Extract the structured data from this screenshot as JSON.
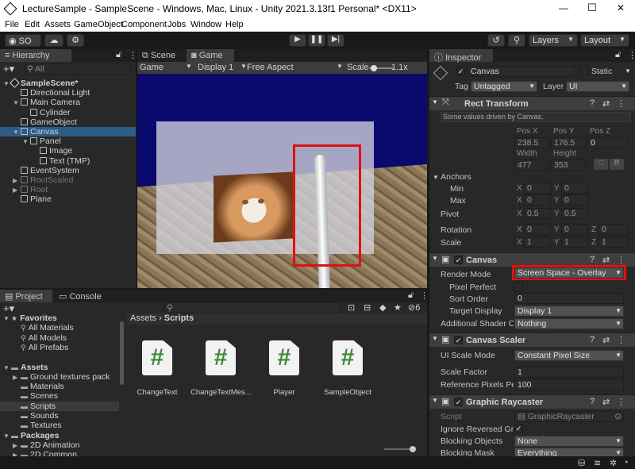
{
  "window": {
    "title": "LectureSample - SampleScene - Windows, Mac, Linux - Unity 2021.3.13f1 Personal* <DX11>",
    "min": "—",
    "max": "☐",
    "close": "✕"
  },
  "menu": [
    "File",
    "Edit",
    "Assets",
    "GameObject",
    "Component",
    "Jobs",
    "Window",
    "Help"
  ],
  "toolbar": {
    "account": "SO",
    "layers": "Layers",
    "layout": "Layout"
  },
  "hierarchy": {
    "tab": "Hierarchy",
    "search_placeholder": "All",
    "rows": [
      {
        "label": "SampleScene*",
        "depth": 0,
        "arrow": "▼",
        "icon": "unity-icon",
        "selected": false,
        "dim": false
      },
      {
        "label": "Directional Light",
        "depth": 1,
        "arrow": "",
        "icon": "cube-icon",
        "selected": false,
        "dim": false
      },
      {
        "label": "Main Camera",
        "depth": 1,
        "arrow": "▼",
        "icon": "cube-icon",
        "selected": false,
        "dim": false
      },
      {
        "label": "Cylinder",
        "depth": 2,
        "arrow": "",
        "icon": "cube-icon",
        "selected": false,
        "dim": false
      },
      {
        "label": "GameObject",
        "depth": 1,
        "arrow": "",
        "icon": "cube-icon",
        "selected": false,
        "dim": false
      },
      {
        "label": "Canvas",
        "depth": 1,
        "arrow": "▼",
        "icon": "cube-icon",
        "selected": true,
        "dim": false
      },
      {
        "label": "Panel",
        "depth": 2,
        "arrow": "▼",
        "icon": "cube-icon",
        "selected": false,
        "dim": false
      },
      {
        "label": "Image",
        "depth": 3,
        "arrow": "",
        "icon": "cube-icon",
        "selected": false,
        "dim": false
      },
      {
        "label": "Text (TMP)",
        "depth": 3,
        "arrow": "",
        "icon": "cube-icon",
        "selected": false,
        "dim": false
      },
      {
        "label": "EventSystem",
        "depth": 1,
        "arrow": "",
        "icon": "cube-icon",
        "selected": false,
        "dim": false
      },
      {
        "label": "RootScaled",
        "depth": 1,
        "arrow": "▶",
        "icon": "cube-icon",
        "selected": false,
        "dim": true
      },
      {
        "label": "Root",
        "depth": 1,
        "arrow": "▶",
        "icon": "cube-icon",
        "selected": false,
        "dim": true
      },
      {
        "label": "Plane",
        "depth": 1,
        "arrow": "",
        "icon": "cube-icon",
        "selected": false,
        "dim": false
      }
    ]
  },
  "game": {
    "tab_scene": "Scene",
    "tab_game": "Game",
    "mode": "Game",
    "display": "Display 1",
    "aspect": "Free Aspect",
    "scale_label": "Scale",
    "scale_value": "1.1x"
  },
  "project": {
    "tab_project": "Project",
    "tab_console": "Console",
    "hidden_count": "6",
    "tree": [
      {
        "label": "Favorites",
        "depth": 0,
        "bold": true,
        "arrow": "▼",
        "icon": "star-icon"
      },
      {
        "label": "All Materials",
        "depth": 1,
        "bold": false,
        "arrow": "",
        "icon": "search-icon"
      },
      {
        "label": "All Models",
        "depth": 1,
        "bold": false,
        "arrow": "",
        "icon": "search-icon"
      },
      {
        "label": "All Prefabs",
        "depth": 1,
        "bold": false,
        "arrow": "",
        "icon": "search-icon"
      },
      {
        "label": "",
        "depth": 0,
        "bold": false,
        "arrow": "",
        "icon": ""
      },
      {
        "label": "Assets",
        "depth": 0,
        "bold": true,
        "arrow": "▼",
        "icon": "folder-icon"
      },
      {
        "label": "Ground textures pack",
        "depth": 1,
        "bold": false,
        "arrow": "▶",
        "icon": "folder-icon"
      },
      {
        "label": "Materials",
        "depth": 1,
        "bold": false,
        "arrow": "",
        "icon": "folder-icon"
      },
      {
        "label": "Scenes",
        "depth": 1,
        "bold": false,
        "arrow": "",
        "icon": "folder-icon"
      },
      {
        "label": "Scripts",
        "depth": 1,
        "bold": false,
        "arrow": "",
        "icon": "folder-icon",
        "selected": true
      },
      {
        "label": "Sounds",
        "depth": 1,
        "bold": false,
        "arrow": "",
        "icon": "folder-icon"
      },
      {
        "label": "Textures",
        "depth": 1,
        "bold": false,
        "arrow": "",
        "icon": "folder-icon"
      },
      {
        "label": "Packages",
        "depth": 0,
        "bold": true,
        "arrow": "▼",
        "icon": "folder-icon"
      },
      {
        "label": "2D Animation",
        "depth": 1,
        "bold": false,
        "arrow": "▶",
        "icon": "folder-icon"
      },
      {
        "label": "2D Common",
        "depth": 1,
        "bold": false,
        "arrow": "▶",
        "icon": "folder-icon"
      }
    ],
    "breadcrumb": [
      "Assets",
      "Scripts"
    ],
    "files": [
      "ChangeText",
      "ChangeTextMes...",
      "Player",
      "SampleObject"
    ]
  },
  "inspector": {
    "tab": "Inspector",
    "object_name": "Canvas",
    "static_label": "Static",
    "tag_label": "Tag",
    "tag_value": "Untagged",
    "layer_label": "Layer",
    "layer_value": "UI",
    "rect": {
      "title": "Rect Transform",
      "note": "Some values driven by Canvas.",
      "posx_label": "Pos X",
      "posy_label": "Pos Y",
      "posz_label": "Pos Z",
      "posx": "238.5",
      "posy": "176.5",
      "posz": "0",
      "width_label": "Width",
      "height_label": "Height",
      "width": "477",
      "height": "353",
      "anchors_label": "Anchors",
      "min_label": "Min",
      "max_label": "Max",
      "min_x": "0",
      "min_y": "0",
      "max_x": "0",
      "max_y": "0",
      "pivot_label": "Pivot",
      "pivot_x": "0.5",
      "pivot_y": "0.5",
      "rotation_label": "Rotation",
      "rot_x": "0",
      "rot_y": "0",
      "rot_z": "0",
      "scale_label": "Scale",
      "scale_x": "1",
      "scale_y": "1",
      "scale_z": "1",
      "x": "X",
      "y": "Y",
      "z": "Z",
      "r": "R"
    },
    "canvas": {
      "title": "Canvas",
      "render_mode_label": "Render Mode",
      "render_mode": "Screen Space - Overlay",
      "pixel_perfect_label": "Pixel Perfect",
      "sort_order_label": "Sort Order",
      "sort_order": "0",
      "target_display_label": "Target Display",
      "target_display": "Display 1",
      "shader_label": "Additional Shader Ch",
      "shader_value": "Nothing"
    },
    "scaler": {
      "title": "Canvas Scaler",
      "ui_scale_label": "UI Scale Mode",
      "ui_scale": "Constant Pixel Size",
      "scale_factor_label": "Scale Factor",
      "scale_factor": "1",
      "ref_ppu_label": "Reference Pixels Per",
      "ref_ppu": "100"
    },
    "raycaster": {
      "title": "Graphic Raycaster",
      "script_label": "Script",
      "script_value": "GraphicRaycaster",
      "ignore_label": "Ignore Reversed Grap",
      "blocking_objects_label": "Blocking Objects",
      "blocking_objects": "None",
      "blocking_mask_label": "Blocking Mask",
      "blocking_mask": "Everything"
    }
  },
  "colors": {
    "highlight": "#e01010",
    "selection": "#2c5d87"
  }
}
